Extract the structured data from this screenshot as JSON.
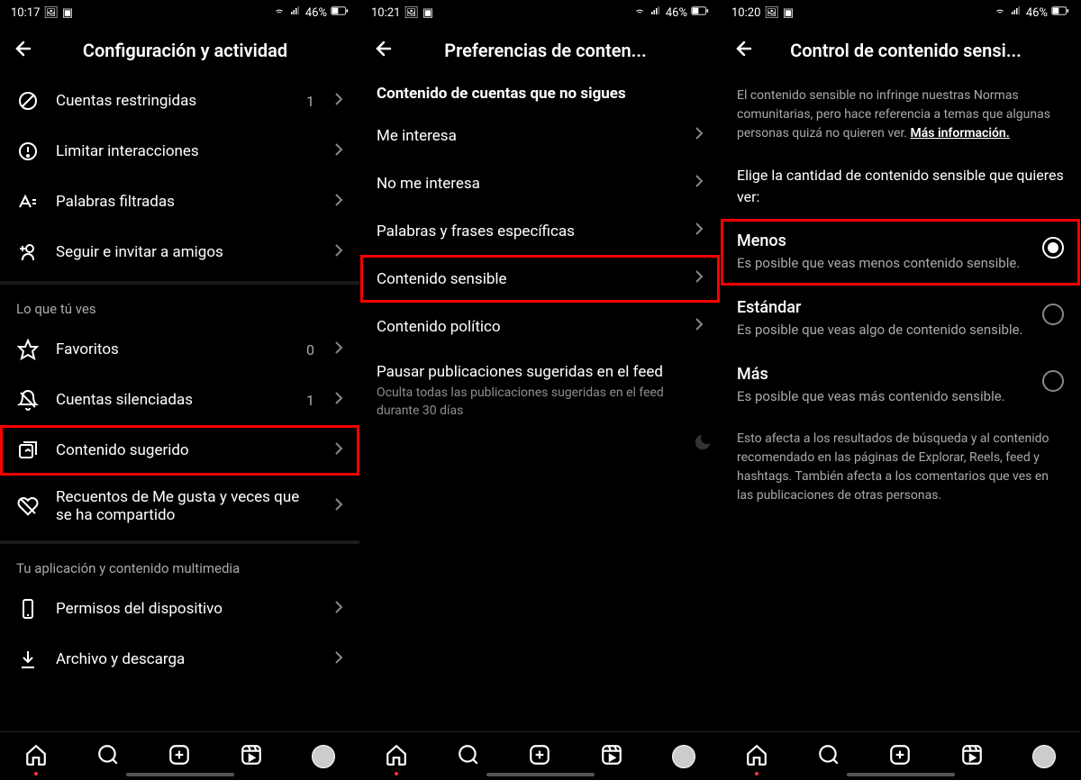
{
  "screen1": {
    "status": {
      "time": "10:17",
      "battery": "46%"
    },
    "title": "Configuración y actividad",
    "items": [
      {
        "label": "Cuentas restringidas",
        "badge": "1"
      },
      {
        "label": "Limitar interacciones"
      },
      {
        "label": "Palabras filtradas"
      },
      {
        "label": "Seguir e invitar a amigos"
      }
    ],
    "section2_title": "Lo que tú ves",
    "items2": [
      {
        "label": "Favoritos",
        "badge": "0"
      },
      {
        "label": "Cuentas silenciadas",
        "badge": "1"
      },
      {
        "label": "Contenido sugerido"
      },
      {
        "label": "Recuentos de Me gusta y veces que se ha compartido"
      }
    ],
    "section3_title": "Tu aplicación y contenido multimedia",
    "items3": [
      {
        "label": "Permisos del dispositivo"
      },
      {
        "label": "Archivo y descarga"
      }
    ]
  },
  "screen2": {
    "status": {
      "time": "10:21",
      "battery": "46%"
    },
    "title": "Preferencias de conten...",
    "section_title": "Contenido de cuentas que no sigues",
    "rows": [
      {
        "label": "Me interesa"
      },
      {
        "label": "No me interesa"
      },
      {
        "label": "Palabras y frases específicas"
      },
      {
        "label": "Contenido sensible"
      },
      {
        "label": "Contenido político"
      }
    ],
    "pause": {
      "title": "Pausar publicaciones sugeridas en el feed",
      "desc": "Oculta todas las publicaciones sugeridas en el feed durante 30 días"
    }
  },
  "screen3": {
    "status": {
      "time": "10:20",
      "battery": "46%"
    },
    "title": "Control de contenido sensi...",
    "info_pre": "El contenido sensible no infringe nuestras Normas comunitarias, pero hace referencia a temas que algunas personas quizá no quieren ver. ",
    "info_link": "Más información.",
    "prompt": "Elige la cantidad de contenido sensible que quieres ver:",
    "options": [
      {
        "title": "Menos",
        "desc": "Es posible que veas menos contenido sensible."
      },
      {
        "title": "Estándar",
        "desc": "Es posible que veas algo de contenido sensible."
      },
      {
        "title": "Más",
        "desc": "Es posible que veas más contenido sensible."
      }
    ],
    "footer": "Esto afecta a los resultados de búsqueda y al contenido recomendado en las páginas de Explorar, Reels, feed y hashtags. También afecta a los comentarios que ves en las publicaciones de otras personas."
  }
}
